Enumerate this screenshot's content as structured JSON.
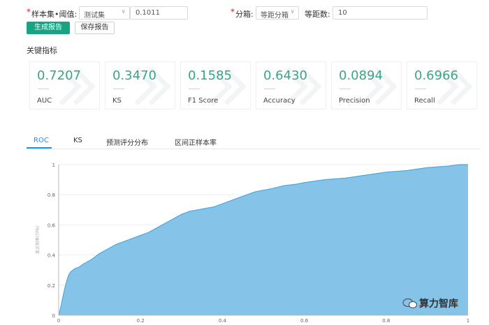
{
  "form": {
    "sample_label": "样本集•阈值:",
    "sample_select": "测试集",
    "threshold_value": "0.1011",
    "binning_label": "分箱:",
    "binning_select": "等距分箱",
    "bins_label": "等距数:",
    "bins_value": "10"
  },
  "actions": {
    "generate_label": "生成报告",
    "save_label": "保存报告"
  },
  "metrics_title": "关键指标",
  "metrics": [
    {
      "value": "0.7207",
      "name": "AUC"
    },
    {
      "value": "0.3470",
      "name": "KS"
    },
    {
      "value": "0.1585",
      "name": "F1 Score"
    },
    {
      "value": "0.6430",
      "name": "Accuracy"
    },
    {
      "value": "0.0894",
      "name": "Precision"
    },
    {
      "value": "0.6966",
      "name": "Recall"
    }
  ],
  "tabs": [
    "ROC",
    "KS",
    "预测评分分布",
    "区间正样本率"
  ],
  "active_tab": "ROC",
  "watermark": "算力智库",
  "colors": {
    "accent": "#18a383",
    "metric_value": "#3aa487",
    "tab_active": "#1890ff",
    "area_fill": "#85c4e8",
    "area_line": "#4fa7dc",
    "required": "#e02020"
  },
  "chart_data": {
    "type": "area",
    "xlabel": "",
    "ylabel": "真正例率(TPR)",
    "xlim": [
      0,
      1
    ],
    "ylim": [
      0,
      1
    ],
    "x_ticks": [
      "0",
      "0.2",
      "0.4",
      "0.6",
      "0.8",
      "1"
    ],
    "y_ticks": [
      "0",
      "0.2",
      "0.4",
      "0.6",
      "0.8",
      "1"
    ],
    "grid": true,
    "series": [
      {
        "x": [
          0,
          0.005,
          0.01,
          0.015,
          0.02,
          0.025,
          0.03,
          0.04,
          0.05,
          0.06,
          0.08,
          0.1,
          0.12,
          0.14,
          0.16,
          0.18,
          0.2,
          0.22,
          0.24,
          0.26,
          0.28,
          0.3,
          0.32,
          0.34,
          0.36,
          0.38,
          0.4,
          0.42,
          0.44,
          0.46,
          0.48,
          0.5,
          0.52,
          0.55,
          0.58,
          0.6,
          0.65,
          0.7,
          0.75,
          0.8,
          0.85,
          0.9,
          0.95,
          0.98,
          1.0
        ],
        "y": [
          0,
          0.05,
          0.12,
          0.18,
          0.23,
          0.27,
          0.29,
          0.31,
          0.32,
          0.34,
          0.37,
          0.41,
          0.44,
          0.47,
          0.49,
          0.51,
          0.53,
          0.55,
          0.58,
          0.61,
          0.64,
          0.67,
          0.69,
          0.7,
          0.71,
          0.72,
          0.74,
          0.76,
          0.78,
          0.8,
          0.82,
          0.83,
          0.84,
          0.86,
          0.87,
          0.88,
          0.9,
          0.91,
          0.93,
          0.95,
          0.96,
          0.98,
          0.99,
          1.0,
          1.0
        ]
      }
    ]
  }
}
